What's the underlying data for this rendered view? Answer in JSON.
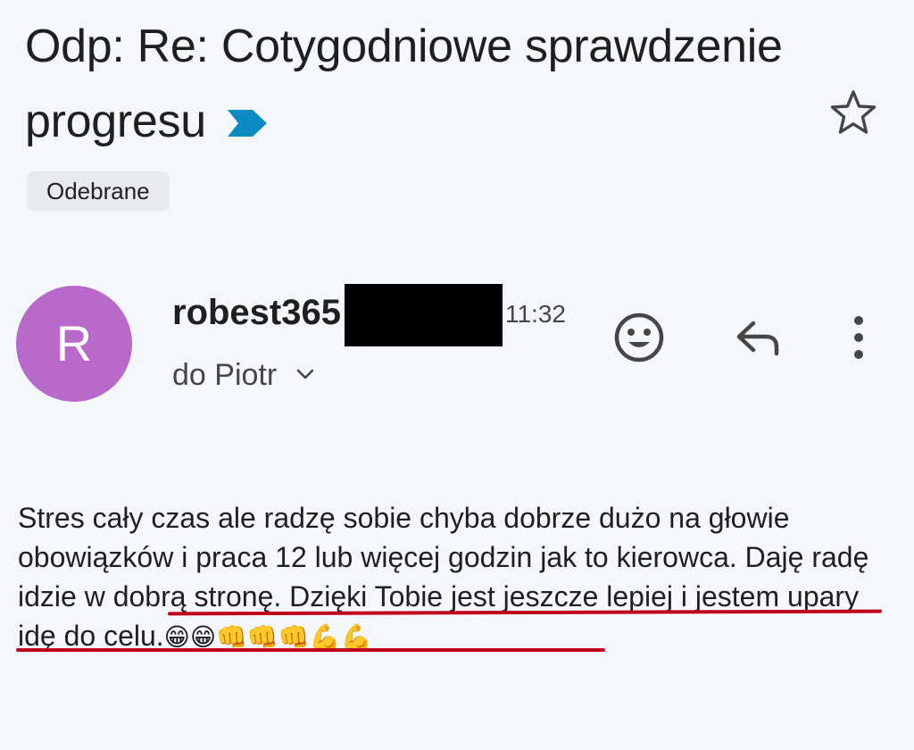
{
  "email": {
    "subject": "Odp: Re: Cotygodniowe sprawdzenie progresu",
    "label": "Odebrane",
    "sender_initial": "R",
    "sender": "robest365",
    "time": "11:32",
    "recipient": "do Piotr",
    "body": "Stres cały czas ale radzę sobie chyba dobrze dużo na głowie obowiązków i praca 12 lub więcej godzin jak to kierowca. Daję radę idzie w dobrą stronę. Dzięki Tobie jest jeszcze lepiej i jestem upary idę do celu.",
    "emojis": "😁😁👊👊👊💪💪"
  },
  "icons": {
    "importance": "importance-marker-icon",
    "star": "star-icon",
    "chevron": "chevron-down-icon",
    "emoji": "emoji-reaction-icon",
    "reply": "reply-icon",
    "more": "more-vert-icon"
  },
  "colors": {
    "background": "#f4f8fd",
    "avatar": "#b969c9",
    "importance": "#0b8bc2",
    "underline": "#c0001d"
  }
}
